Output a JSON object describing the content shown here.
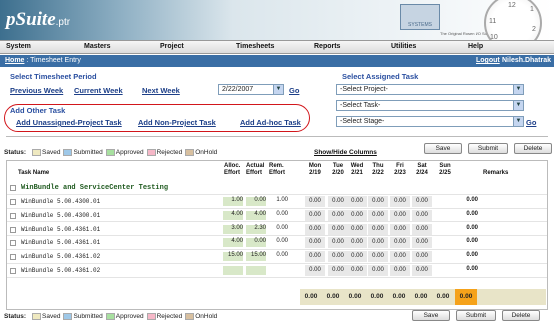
{
  "app": {
    "logo": "pSuite",
    "logo_suffix": ".ptr",
    "brand": "SYSTEMS",
    "tagline": "The Original Rosen I/O Software Products",
    "clock": [
      "11",
      "12",
      "1",
      "10",
      "2"
    ]
  },
  "menu": [
    "System",
    "Masters",
    "Project",
    "Timesheets",
    "Reports",
    "Utilities",
    "Help"
  ],
  "crumb": {
    "home": "Home",
    "title": " : Timesheet Entry",
    "logout": "Logout",
    "user": "Nilesh.Dhatrak"
  },
  "period": {
    "title": "Select Timesheet Period",
    "prev": "Previous Week",
    "curr": "Current Week",
    "next": "Next Week",
    "date": "2/22/2007",
    "go": "Go"
  },
  "assigned": {
    "title": "Select Assigned Task",
    "project": "-Select Project-",
    "task": "-Select Task-",
    "stage": "-Select Stage-",
    "go": "Go"
  },
  "other": {
    "title": "Add Other Task",
    "a": "Add Unassigned-Project Task",
    "b": "Add Non-Project Task",
    "c": "Add Ad-hoc Task"
  },
  "buttons": {
    "save": "Save",
    "submit": "Submit",
    "delete": "Delete"
  },
  "status": {
    "label": "Status:",
    "items": [
      {
        "name": "Saved",
        "color": "#efe9c0"
      },
      {
        "name": "Submitted",
        "color": "#9ec8e8"
      },
      {
        "name": "Approved",
        "color": "#a8e0a0"
      },
      {
        "name": "Rejected",
        "color": "#f6b8c8"
      },
      {
        "name": "OnHold",
        "color": "#d8c0a0"
      }
    ],
    "toggle": "Show/Hide Columns"
  },
  "grid": {
    "headers": {
      "task": "Task Name",
      "alloc": "Alloc. Effort",
      "actual": "Actual Effort",
      "rem": "Rem. Effort",
      "days": [
        [
          "Mon",
          "2/19"
        ],
        [
          "Tue",
          "2/20"
        ],
        [
          "Wed",
          "2/21"
        ],
        [
          "Thu",
          "2/22"
        ],
        [
          "Fri",
          "2/23"
        ],
        [
          "Sat",
          "2/24"
        ],
        [
          "Sun",
          "2/25"
        ]
      ],
      "remarks": "Remarks"
    },
    "group": "WinBundle and ServiceCenter Testing",
    "rows": [
      {
        "name": "WinBundle 5.00.4300.01",
        "alloc": "1.00",
        "actual": "0.00",
        "rem": "1.00",
        "days": [
          "0.00",
          "0.00",
          "0.00",
          "0.00",
          "0.00",
          "0.00"
        ],
        "total": "0.00"
      },
      {
        "name": "WinBundle 5.00.4300.01",
        "alloc": "4.00",
        "actual": "4.00",
        "rem": "0.00",
        "days": [
          "0.00",
          "0.00",
          "0.00",
          "0.00",
          "0.00",
          "0.00"
        ],
        "total": "0.00"
      },
      {
        "name": "WinBundle 5.00.4361.01",
        "alloc": "3.00",
        "actual": "2.30",
        "rem": "0.00",
        "days": [
          "0.00",
          "0.00",
          "0.00",
          "0.00",
          "0.00",
          "0.00"
        ],
        "total": "0.00"
      },
      {
        "name": "WinBundle 5.00.4361.01",
        "alloc": "4.00",
        "actual": "0.00",
        "rem": "0.00",
        "days": [
          "0.00",
          "0.00",
          "0.00",
          "0.00",
          "0.00",
          "0.00"
        ],
        "total": "0.00"
      },
      {
        "name": "winBundle 5.00.4361.02",
        "alloc": "15.00",
        "actual": "15.00",
        "rem": "0.00",
        "days": [
          "0.00",
          "0.00",
          "0.00",
          "0.00",
          "0.00",
          "0.00"
        ],
        "total": "0.00"
      },
      {
        "name": "WinBundle 5.00.4361.02",
        "alloc": "",
        "actual": "",
        "rem": "",
        "days": [
          "0.00",
          "0.00",
          "0.00",
          "0.00",
          "0.00",
          "0.00"
        ],
        "total": "0.00"
      }
    ],
    "totals": [
      "0.00",
      "0.00",
      "0.00",
      "0.00",
      "0.00",
      "0.00",
      "0.00",
      "0.00"
    ]
  }
}
